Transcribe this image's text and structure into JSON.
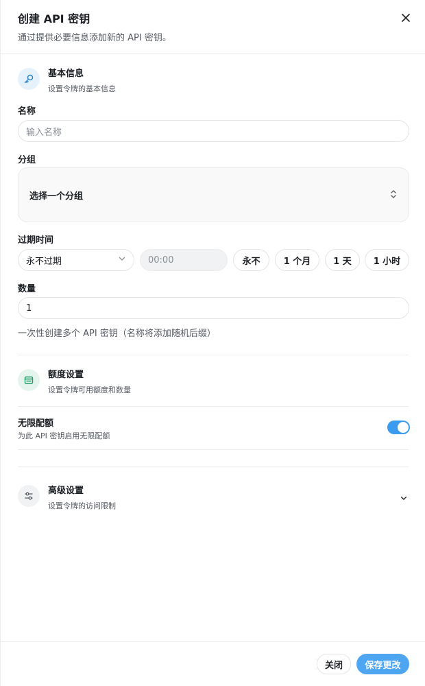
{
  "header": {
    "title": "创建 API 密钥",
    "subtitle": "通过提供必要信息添加新的 API 密钥。"
  },
  "basic": {
    "title": "基本信息",
    "desc": "设置令牌的基本信息",
    "icon": "key-icon",
    "name_label": "名称",
    "name_placeholder": "输入名称",
    "group_label": "分组",
    "group_value": "选择一个分组",
    "expire_label": "过期时间",
    "expire_value": "永不过期",
    "time_placeholder": "00:00",
    "quick_options": [
      "永不",
      "1 个月",
      "1 天",
      "1 小时"
    ],
    "count_label": "数量",
    "count_value": "1",
    "count_helper": "一次性创建多个 API 密钥（名称将添加随机后缀）"
  },
  "quota": {
    "title": "额度设置",
    "desc": "设置令牌可用额度和数量",
    "icon": "wallet-icon",
    "unlimited_label": "无限配额",
    "unlimited_desc": "为此 API 密钥启用无限配额",
    "unlimited_on": true
  },
  "advanced": {
    "title": "高级设置",
    "desc": "设置令牌的访问限制",
    "icon": "sliders-icon"
  },
  "footer": {
    "close_label": "关闭",
    "save_label": "保存更改"
  },
  "colors": {
    "accent": "#4ea6f2",
    "toggle_on": "#3b9bef"
  }
}
